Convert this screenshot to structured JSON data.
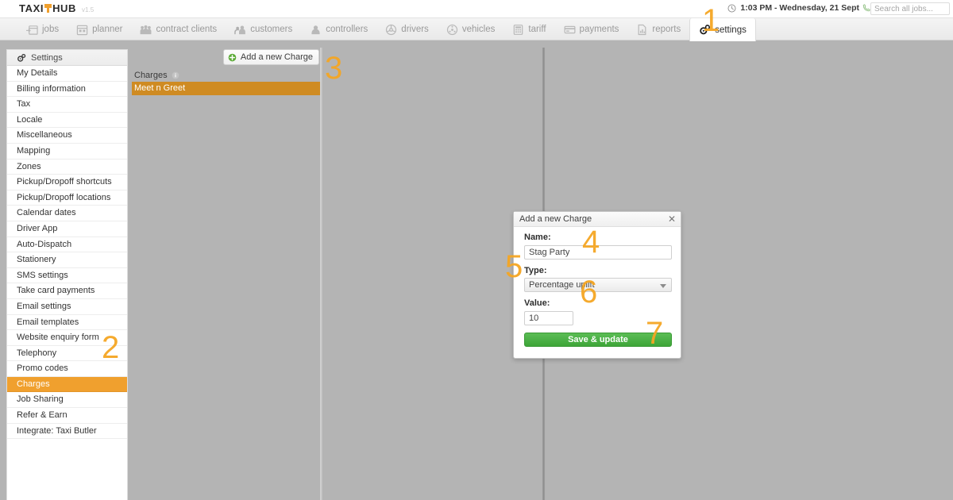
{
  "app": {
    "logo_left": "TAXI",
    "logo_right": "HUB",
    "version": "v1.5",
    "accent_color": "#f0a02e",
    "save_color": "#3da538",
    "annotation_color": "#f5a623"
  },
  "topbar": {
    "clock_icon": "clock-icon",
    "datetime": "1:03 PM - Wednesday, 21 Sept",
    "phone_icon": "phone-icon",
    "search_placeholder": "Search all jobs...",
    "search_value": ""
  },
  "nav": {
    "tabs": [
      {
        "label": "jobs",
        "icon": "calendar-arrow-icon",
        "active": false
      },
      {
        "label": "planner",
        "icon": "calendar-icon",
        "active": false
      },
      {
        "label": "contract clients",
        "icon": "people-group-icon",
        "active": false
      },
      {
        "label": "customers",
        "icon": "two-users-icon",
        "active": false
      },
      {
        "label": "controllers",
        "icon": "user-headset-icon",
        "active": false
      },
      {
        "label": "drivers",
        "icon": "steering-wheel-icon",
        "active": false
      },
      {
        "label": "vehicles",
        "icon": "car-wheel-icon",
        "active": false
      },
      {
        "label": "tariff",
        "icon": "calculator-icon",
        "active": false
      },
      {
        "label": "payments",
        "icon": "credit-card-icon",
        "active": false
      },
      {
        "label": "reports",
        "icon": "document-chart-icon",
        "active": false
      },
      {
        "label": "settings",
        "icon": "gears-icon",
        "active": true
      }
    ]
  },
  "sidebar": {
    "header": "Settings",
    "header_icon": "gears-icon",
    "items": [
      {
        "label": "My Details",
        "selected": false
      },
      {
        "label": "Billing information",
        "selected": false
      },
      {
        "label": "Tax",
        "selected": false
      },
      {
        "label": "Locale",
        "selected": false
      },
      {
        "label": "Miscellaneous",
        "selected": false
      },
      {
        "label": "Mapping",
        "selected": false
      },
      {
        "label": "Zones",
        "selected": false
      },
      {
        "label": "Pickup/Dropoff shortcuts",
        "selected": false
      },
      {
        "label": "Pickup/Dropoff locations",
        "selected": false
      },
      {
        "label": "Calendar dates",
        "selected": false
      },
      {
        "label": "Driver App",
        "selected": false
      },
      {
        "label": "Auto-Dispatch",
        "selected": false
      },
      {
        "label": "Stationery",
        "selected": false
      },
      {
        "label": "SMS settings",
        "selected": false
      },
      {
        "label": "Take card payments",
        "selected": false
      },
      {
        "label": "Email settings",
        "selected": false
      },
      {
        "label": "Email templates",
        "selected": false
      },
      {
        "label": "Website enquiry form",
        "selected": false
      },
      {
        "label": "Telephony",
        "selected": false
      },
      {
        "label": "Promo codes",
        "selected": false
      },
      {
        "label": "Charges",
        "selected": true
      },
      {
        "label": "Job Sharing",
        "selected": false
      },
      {
        "label": "Refer & Earn",
        "selected": false
      },
      {
        "label": "Integrate: Taxi Butler",
        "selected": false
      }
    ]
  },
  "charges_panel": {
    "add_button_label": "Add a new Charge",
    "add_button_icon": "plus-circle-icon",
    "list_header": "Charges",
    "list_header_icon": "info-icon",
    "rows": [
      {
        "label": "Meet n Greet",
        "selected": true
      }
    ]
  },
  "modal": {
    "title": "Add a new Charge",
    "close_icon": "close-icon",
    "name_label": "Name:",
    "name_value": "Stag Party",
    "type_label": "Type:",
    "type_value": "Percentage uplift",
    "type_caret_icon": "chevron-down-icon",
    "value_label": "Value:",
    "value_value": "10",
    "save_label": "Save & update"
  },
  "annotations": [
    {
      "num": "1"
    },
    {
      "num": "2"
    },
    {
      "num": "3"
    },
    {
      "num": "4"
    },
    {
      "num": "5"
    },
    {
      "num": "6"
    },
    {
      "num": "7"
    }
  ]
}
